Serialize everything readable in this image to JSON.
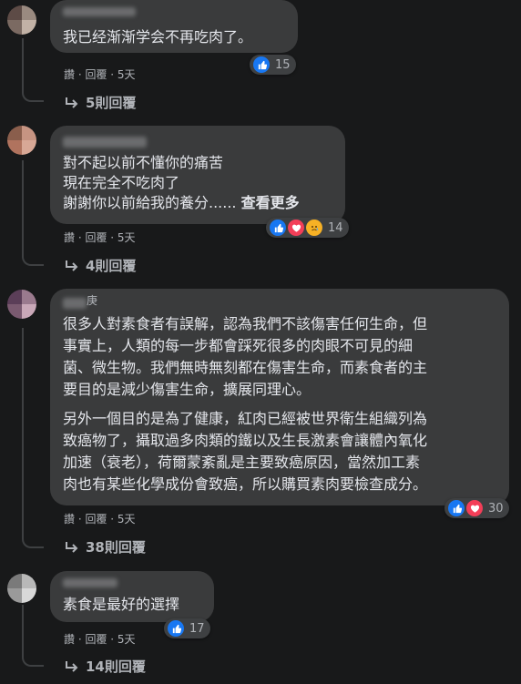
{
  "comments": [
    {
      "text": "我已经渐渐学会不再吃肉了。",
      "meta": "讚 · 回覆 · 5天",
      "reaction_count": "15",
      "replies": "5則回覆"
    },
    {
      "lines": [
        "對不起以前不懂你的痛苦",
        "現在完全不吃肉了",
        "謝謝你以前給我的養分......"
      ],
      "see_more": "查看更多",
      "meta": "讚 · 回覆 · 5天",
      "reaction_count": "14",
      "replies": "4則回覆"
    },
    {
      "name_fragment": "庚",
      "para1": [
        "很多人對素食者有誤解，認為我們不該傷害任何生命，但",
        "事實上，人類的每一步都會踩死很多的肉眼不可見的細",
        "菌、微生物。我們無時無刻都在傷害生命，而素食者的主",
        "要目的是減少傷害生命，擴展同理心。"
      ],
      "para2": [
        "另外一個目的是為了健康，紅肉已經被世界衛生組織列為",
        "致癌物了，攝取過多肉類的鐵以及生長激素會讓體內氧化",
        "加速（衰老），荷爾蒙紊亂是主要致癌原因，當然加工素",
        "肉也有某些化學成份會致癌，所以購買素肉要檢查成分。"
      ],
      "meta": "讚 · 回覆 · 5天",
      "reaction_count": "30",
      "replies": "38則回覆"
    },
    {
      "text": "素食是最好的選擇",
      "meta": "讚 · 回覆 · 5天",
      "reaction_count": "17",
      "replies": "14則回覆"
    }
  ],
  "icons": {
    "like": "like-icon",
    "love": "love-icon",
    "sad": "sad-icon",
    "reply_arrow": "reply-arrow-icon"
  },
  "colors": {
    "background": "#18191a",
    "bubble": "#3a3b3c",
    "like": "#1877f2",
    "love": "#f33e58",
    "sad": "#f7b125"
  }
}
